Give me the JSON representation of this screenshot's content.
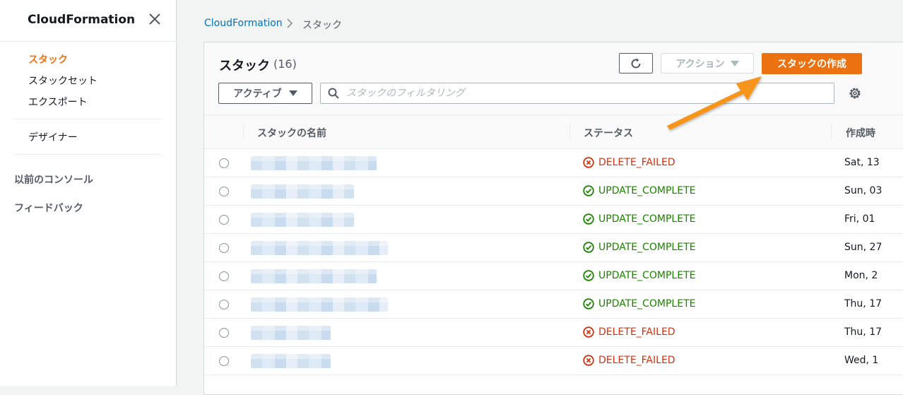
{
  "sidebar": {
    "title": "CloudFormation",
    "items": [
      {
        "label": "スタック",
        "active": true
      },
      {
        "label": "スタックセット"
      },
      {
        "label": "エクスポート"
      },
      {
        "label": "デザイナー"
      },
      {
        "label": "以前のコンソール"
      },
      {
        "label": "フィードバック"
      }
    ]
  },
  "breadcrumb": {
    "root": "CloudFormation",
    "current": "スタック"
  },
  "panel": {
    "title": "スタック",
    "count": "(16)",
    "action_label": "アクション",
    "create_label": "スタックの作成",
    "filter_label": "アクティブ",
    "search_placeholder": "スタックのフィルタリング"
  },
  "table": {
    "columns": [
      "スタックの名前",
      "ステータス",
      "作成時"
    ],
    "rows": [
      {
        "status": "DELETE_FAILED",
        "type": "failed",
        "date": "Sat, 13"
      },
      {
        "status": "UPDATE_COMPLETE",
        "type": "ok",
        "date": "Sun, 03"
      },
      {
        "status": "UPDATE_COMPLETE",
        "type": "ok",
        "date": "Fri, 01"
      },
      {
        "status": "UPDATE_COMPLETE",
        "type": "ok",
        "date": "Sun, 27"
      },
      {
        "status": "UPDATE_COMPLETE",
        "type": "ok",
        "date": "Mon, 2"
      },
      {
        "status": "UPDATE_COMPLETE",
        "type": "ok",
        "date": "Thu, 17"
      },
      {
        "status": "DELETE_FAILED",
        "type": "failed",
        "date": "Thu, 17"
      },
      {
        "status": "DELETE_FAILED",
        "type": "failed",
        "date": "Wed, 1"
      }
    ]
  },
  "colors": {
    "accent": "#ec7211",
    "link": "#0073bb",
    "failed": "#d13212",
    "ok": "#1d8102",
    "annotation_arrow": "#f7941d"
  },
  "icons": [
    "close-icon",
    "chevron-right-icon",
    "refresh-icon",
    "caret-down-icon",
    "search-icon",
    "gear-icon",
    "error-circle-icon",
    "check-circle-icon"
  ]
}
